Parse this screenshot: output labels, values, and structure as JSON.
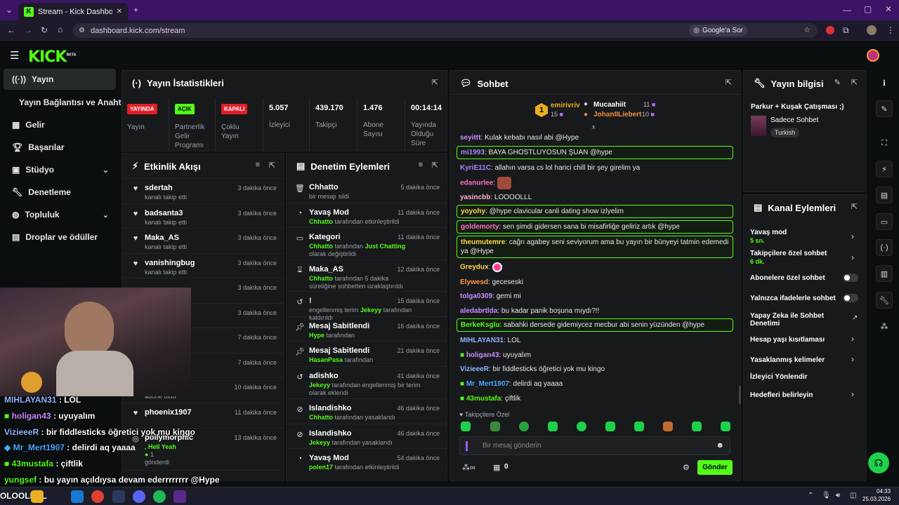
{
  "browser": {
    "tab_title": "Stream - Kick Dashboard",
    "url": "dashboard.kick.com/stream",
    "google_pill": "Google'a Sor"
  },
  "header": {
    "logo": "KICK",
    "logo_sup": "BETA"
  },
  "nav": {
    "items": [
      {
        "label": "Yayın"
      },
      {
        "label": "Yayın Bağlantısı ve Anahtarı"
      },
      {
        "label": "Gelir"
      },
      {
        "label": "Başarılar"
      },
      {
        "label": "Stüdyo"
      },
      {
        "label": "Denetleme"
      },
      {
        "label": "Topluluk"
      },
      {
        "label": "Droplar ve ödüller"
      }
    ]
  },
  "stats": {
    "title": "Yayın İstatistikleri",
    "cells": [
      {
        "badge": "YAYINDA",
        "label": "Yayın"
      },
      {
        "badge": "AÇIK",
        "label": "Partnerlik Gelir Programı"
      },
      {
        "badge": "KAPALI",
        "label": "Çoklu Yayın"
      },
      {
        "value": "5.057",
        "label": "İzleyici"
      },
      {
        "value": "439.170",
        "label": "Takipçi"
      },
      {
        "value": "1.476",
        "label": "Abone Sayısı"
      },
      {
        "value": "00:14:14",
        "label": "Yayında Olduğu Süre"
      }
    ]
  },
  "activity": {
    "title": "Etkinlik Akışı",
    "rows": [
      {
        "name": "sdertah",
        "sub": "kanalı takip etti",
        "time": "3 dakika önce"
      },
      {
        "name": "badsanta3",
        "sub": "kanalı takip etti",
        "time": "3 dakika önce"
      },
      {
        "name": "Maka_AS",
        "sub": "kanalı takip etti",
        "time": "3 dakika önce"
      },
      {
        "name": "vanishingbug",
        "sub": "kanalı takip etti",
        "time": "3 dakika önce"
      },
      {
        "name": "",
        "sub": "",
        "time": "3 dakika önce"
      },
      {
        "name": "",
        "sub": "",
        "time": "3 dakika önce"
      },
      {
        "name": "",
        "sub": "",
        "time": "7 dakika önce"
      },
      {
        "name": "",
        "sub": "",
        "time": "7 dakika önce"
      },
      {
        "name": "k",
        "sub": "abone oldu",
        "time": "10 dakika önce"
      },
      {
        "name": "phoenix1907",
        "sub": "",
        "time": "11 dakika önce"
      },
      {
        "name": "pollymorphic",
        "sub": ", Hell Yeah",
        "sub2": "1",
        "sub3": "gönderdi",
        "time": "13 dakika önce"
      }
    ]
  },
  "moderation": {
    "title": "Denetim Eylemleri",
    "rows": [
      {
        "name": "Chhatto",
        "sub": "bir mesajı sildi",
        "time": "5 dakika önce"
      },
      {
        "name": "Yavaş Mod",
        "actor": "Chhatto",
        "sub": "tarafından etkinleştirildi",
        "time": "11 dakika önce"
      },
      {
        "name": "Kategori",
        "actor": "Chhatto",
        "sub": "tarafından",
        "extra": "Just Chatting",
        "sub2": "olarak değiştirildi",
        "time": "11 dakika önce"
      },
      {
        "name": "Maka_AS",
        "actor": "Chhatto",
        "sub": "tarafından 5 dakika süreliğine sohbetten uzaklaştırıldı",
        "time": "12 dakika önce"
      },
      {
        "name": "!",
        "sub": "engellenmiş terim",
        "actor": "Jekeyy",
        "sub2": "tarafından kaldırıldı",
        "time": "15 dakika önce"
      },
      {
        "name": "Mesaj Sabitlendi",
        "actor": "Hype",
        "sub": "tarafından",
        "time": "16 dakika önce"
      },
      {
        "name": "Mesaj Sabitlendi",
        "actor": "HasanPasa",
        "sub": "tarafından",
        "time": "21 dakika önce"
      },
      {
        "name": "adishko",
        "actor": "Jekeyy",
        "sub": "tarafından engellenmiş bir terim olarak eklendi",
        "time": "41 dakika önce"
      },
      {
        "name": "Islandishko",
        "actor": "Chhatto",
        "sub": "tarafından yasaklandı",
        "time": "46 dakika önce"
      },
      {
        "name": "Islandishko",
        "actor": "Jekeyy",
        "sub": "tarafından yasaklandı",
        "time": "46 dakika önce"
      },
      {
        "name": "Yavaş Mod",
        "actor": "polen17",
        "sub": "tarafından etkinleştirildi",
        "time": "54 dakika önce"
      }
    ]
  },
  "chat": {
    "title": "Sohbet",
    "leaders": {
      "rank": "1",
      "first": {
        "name": "emirivriv",
        "count": "15"
      },
      "second": {
        "name": "Mucaahiit",
        "count": "11"
      },
      "third": {
        "name": "JohanIILiebert",
        "count": "10"
      }
    },
    "messages": [
      {
        "user": "seyittt",
        "text": "Kulak kebabı nasıl abi @Hype",
        "color": "#c88cff"
      },
      {
        "user": "mi1993",
        "text": "BAYA GHOSTLUYOSUN ŞUAN @hype",
        "color": "#a684ff"
      },
      {
        "user": "KyriE11C",
        "text": "allahın varsa cs lol harici chill bir şey girelim ya",
        "color": "#a684ff"
      },
      {
        "user": "edanurlee",
        "text": "",
        "color": "#ff6ec7"
      },
      {
        "user": "yasincbb",
        "text": "LOOOOLLL",
        "color": "#ffb0d0"
      },
      {
        "user": "yoyohy",
        "text": "@hype clavicular canli dating show izlyelim",
        "color": "#ffd84a"
      },
      {
        "user": "goldemorty",
        "text": "sen şimdi gidersen sana bi misafirliğe geliriz artık @hype",
        "color": "#ff6ec7"
      },
      {
        "user": "theumutemre",
        "text": "cağrı agabey seni seviyorum ama bu yayın bir bünyeyi tatmin edemedi ya @Hype",
        "color": "#ffd84a"
      },
      {
        "user": "Greydux",
        "text": "",
        "color": "#ffd84a"
      },
      {
        "user": "Elywesd",
        "text": "geceseski",
        "color": "#ff9d4a"
      },
      {
        "user": "tolga0309",
        "text": "gemi mi",
        "color": "#c88cff"
      },
      {
        "user": "aledabrtlda",
        "text": "bu kadar panik boşuna mıydı?!!",
        "color": "#c88cff"
      },
      {
        "user": "BerkeKsglu",
        "text": "sabahki dersede gidemiycez mecbur abi senin yüzünden @hype",
        "color": "#53fc18"
      },
      {
        "user": "MIHLAYAN31",
        "text": "LOL",
        "color": "#8fb4ff"
      },
      {
        "user": "holigan43",
        "text": "uyuyalım",
        "color": "#c88cff"
      },
      {
        "user": "VizieeeR",
        "text": "bir fiddlesticks öğretici yok mu kingo",
        "color": "#8fb4ff"
      },
      {
        "user": "Mr_Mert1907",
        "text": "delirdi aq yaaaa",
        "color": "#4aa8ff"
      },
      {
        "user": "43mustafa",
        "text": "çiftlik",
        "color": "#53fc18"
      }
    ],
    "followers_only": "Takipçilere Özel",
    "input_placeholder": "Bir mesaj gönderin",
    "points": "0",
    "send_label": "Gönder"
  },
  "stream_info": {
    "title": "Yayın bilgisi",
    "stream_title": "Parkur + Kuşak Çatışması ;)",
    "category": "Sadece Sohbet",
    "tag": "Turkish"
  },
  "channel_actions": {
    "title": "Kanal Eylemleri",
    "rows": [
      {
        "label": "Yavaş mod",
        "sub": "5 sn."
      },
      {
        "label": "Takipçilere özel sohbet",
        "sub": "6 dk."
      },
      {
        "label": "Abonelere özel sohbet"
      },
      {
        "label": "Yalnızca ifadelerle sohbet"
      },
      {
        "label": "Yapay Zeka ile Sohbet Denetimi"
      },
      {
        "label": "Hesap yaşı kısıtlaması"
      },
      {
        "label": "Yasaklanmış kelimeler"
      },
      {
        "label": "İzleyici Yönlendir"
      },
      {
        "label": "Hedefleri belirleyin"
      }
    ]
  },
  "overlay": {
    "lines": [
      {
        "user": "MIHLAYAN31",
        "text": ": LOL",
        "color": "#8fb4ff"
      },
      {
        "user": "holigan43",
        "text": ": uyuyalım",
        "color": "#c88cff"
      },
      {
        "user": "VizieeeR",
        "text": ": bir fiddlesticks öğretici yok mu kingo",
        "color": "#8fb4ff"
      },
      {
        "user": "Mr_Mert1907",
        "text": ": delirdi aq yaaaa",
        "color": "#4aa8ff"
      },
      {
        "user": "43mustafa",
        "text": ": çiftlik",
        "color": "#53fc18"
      },
      {
        "user": "yungsef",
        "text": ": bu yayın açıldıysa devam ederrrrrrrr @Hype",
        "color": "#53fc18"
      }
    ],
    "marquee": "OLOOLLOL"
  },
  "taskbar": {
    "time": "04:33",
    "date": "25.03.2026"
  }
}
